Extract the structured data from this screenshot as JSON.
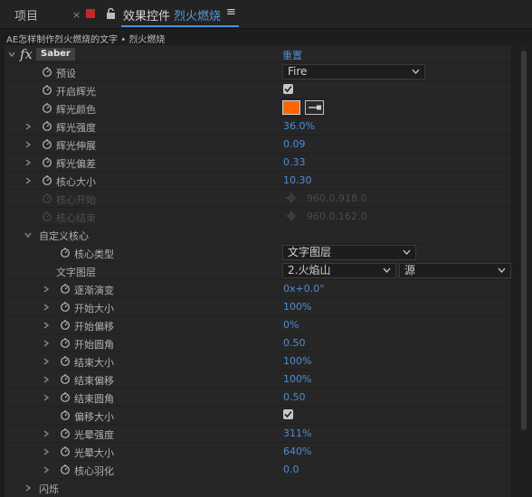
{
  "tabs": {
    "project": "项目",
    "close_glyph": "×",
    "effects": "效果控件",
    "comp_name": "烈火燃烧",
    "menu_glyph": "≡"
  },
  "breadcrumb": "AE怎样制作烈火燃烧的文字 • 烈火燃烧",
  "effect": {
    "fx_glyph": "fx",
    "name": "Saber",
    "reset_label": "重置"
  },
  "controls": {
    "preset": {
      "label": "预设",
      "value": "Fire"
    },
    "enable_glow": {
      "label": "开启辉光",
      "checked": true
    },
    "glow_color": {
      "label": "辉光颜色",
      "color": "#ff6600"
    },
    "glow_intensity": {
      "label": "辉光强度",
      "value": "36.0%"
    },
    "glow_spread": {
      "label": "辉光伸展",
      "value": "0.09"
    },
    "glow_bias": {
      "label": "辉光偏差",
      "value": "0.33"
    },
    "core_size": {
      "label": "核心大小",
      "value": "10.30"
    },
    "core_start": {
      "label": "核心开始",
      "value": "960.0,918.0"
    },
    "core_end": {
      "label": "核心结束",
      "value": "960.0,162.0"
    },
    "custom_core": {
      "label": "自定义核心",
      "core_type": {
        "label": "核心类型",
        "value": "文字图层"
      },
      "text_layer": {
        "label": "文字图层",
        "value": "2.火焰山",
        "source": "源"
      },
      "gradual_change": {
        "label": "逐渐演变",
        "value": "0x+0.0°"
      },
      "start_size": {
        "label": "开始大小",
        "value": "100%"
      },
      "start_offset": {
        "label": "开始偏移",
        "value": "0%"
      },
      "start_roundness": {
        "label": "开始圆角",
        "value": "0.50"
      },
      "end_size": {
        "label": "结束大小",
        "value": "100%"
      },
      "end_offset": {
        "label": "结束偏移",
        "value": "100%"
      },
      "end_roundness": {
        "label": "结束圆角",
        "value": "0.50"
      },
      "offset_size": {
        "label": "偏移大小",
        "checked": true
      },
      "halo_intensity": {
        "label": "光晕强度",
        "value": "311%"
      },
      "halo_size": {
        "label": "光晕大小",
        "value": "640%"
      },
      "core_feather": {
        "label": "核心羽化",
        "value": "0.0"
      }
    },
    "flicker": {
      "label": "闪烁"
    }
  },
  "colors": {
    "accent_blue": "#4e8ed6",
    "tab_highlight": "#4a90d9",
    "label_swatch": "#c1272d"
  },
  "icons": {
    "stopwatch": "stopwatch-icon",
    "lock": "lock-icon",
    "eyedropper": "eyedropper-icon",
    "crosshair": "crosshair-icon",
    "dropdown": "chevron-down-icon",
    "expand": "chevron-right-icon"
  }
}
